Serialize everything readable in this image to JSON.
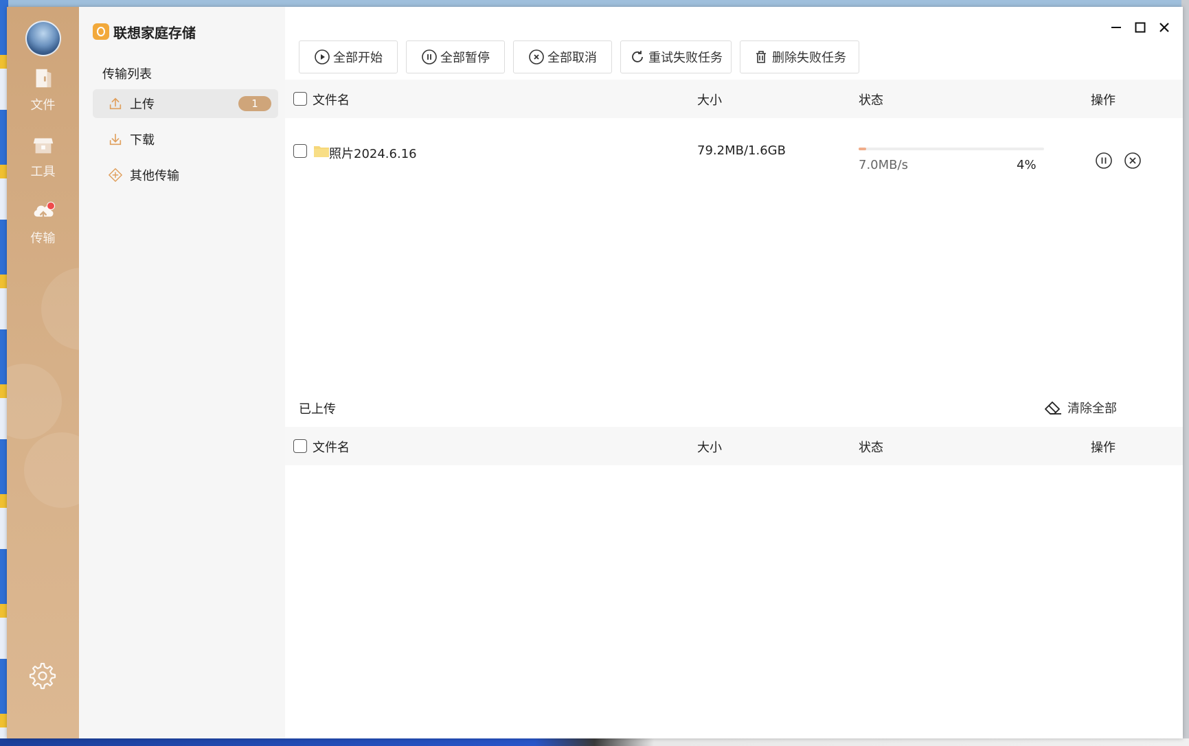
{
  "app": {
    "title": "联想家庭存储",
    "colors": {
      "accent": "#cfa57a",
      "progress": "#f0ad8a",
      "badge": "#cfa57a"
    }
  },
  "rail": {
    "items": [
      {
        "label": "文件",
        "icon": "file-icon"
      },
      {
        "label": "工具",
        "icon": "toolbox-icon"
      },
      {
        "label": "传输",
        "icon": "cloud-upload-icon",
        "has_dot": true
      }
    ],
    "settings_icon": "gear-icon"
  },
  "sidenav": {
    "section_title": "传输列表",
    "items": [
      {
        "label": "上传",
        "icon": "upload-icon",
        "badge": "1",
        "active": true
      },
      {
        "label": "下载",
        "icon": "download-icon"
      },
      {
        "label": "其他传输",
        "icon": "diamond-plus-icon"
      }
    ]
  },
  "toolbar": {
    "start_all": "全部开始",
    "pause_all": "全部暂停",
    "cancel_all": "全部取消",
    "retry_failed": "重试失败任务",
    "delete_failed": "删除失败任务"
  },
  "columns": {
    "filename": "文件名",
    "size": "大小",
    "status": "状态",
    "actions": "操作"
  },
  "uploading": {
    "rows": [
      {
        "filename": "照片2024.6.16",
        "type": "folder",
        "size": "79.2MB/1.6GB",
        "speed": "7.0MB/s",
        "percent_text": "4%",
        "progress": 0.04
      }
    ]
  },
  "uploaded": {
    "title": "已上传",
    "clear_all": "清除全部"
  }
}
